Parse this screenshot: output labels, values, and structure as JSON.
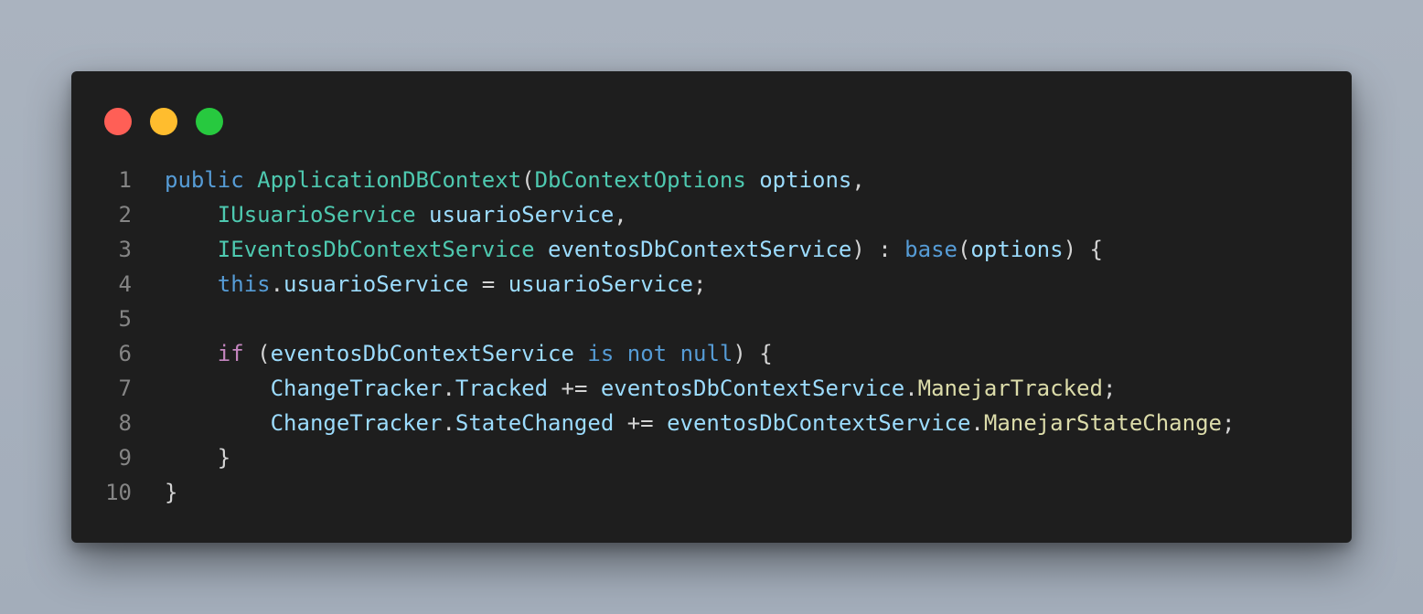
{
  "window": {
    "traffic_lights": [
      {
        "name": "close",
        "color": "#ff5f56"
      },
      {
        "name": "minimize",
        "color": "#ffbd2e"
      },
      {
        "name": "maximize",
        "color": "#27c93f"
      }
    ]
  },
  "theme": {
    "background": "#1e1e1e",
    "keyword": "#569cd6",
    "control": "#c586c0",
    "type": "#4ec9b0",
    "variable": "#9cdcfe",
    "function": "#dcdcaa",
    "punctuation": "#d4d4d4",
    "line_number": "#858585"
  },
  "code": {
    "lines": [
      {
        "n": "1",
        "tokens": [
          {
            "t": "kw",
            "v": "public"
          },
          {
            "t": "pun",
            "v": " "
          },
          {
            "t": "typ",
            "v": "ApplicationDBContext"
          },
          {
            "t": "pun",
            "v": "("
          },
          {
            "t": "typ",
            "v": "DbContextOptions"
          },
          {
            "t": "pun",
            "v": " "
          },
          {
            "t": "var",
            "v": "options"
          },
          {
            "t": "pun",
            "v": ","
          }
        ]
      },
      {
        "n": "2",
        "tokens": [
          {
            "t": "pun",
            "v": "    "
          },
          {
            "t": "typ",
            "v": "IUsuarioService"
          },
          {
            "t": "pun",
            "v": " "
          },
          {
            "t": "var",
            "v": "usuarioService"
          },
          {
            "t": "pun",
            "v": ","
          }
        ]
      },
      {
        "n": "3",
        "tokens": [
          {
            "t": "pun",
            "v": "    "
          },
          {
            "t": "typ",
            "v": "IEventosDbContextService"
          },
          {
            "t": "pun",
            "v": " "
          },
          {
            "t": "var",
            "v": "eventosDbContextService"
          },
          {
            "t": "pun",
            "v": ") : "
          },
          {
            "t": "kw",
            "v": "base"
          },
          {
            "t": "pun",
            "v": "("
          },
          {
            "t": "var",
            "v": "options"
          },
          {
            "t": "pun",
            "v": ") {"
          }
        ]
      },
      {
        "n": "4",
        "tokens": [
          {
            "t": "pun",
            "v": "    "
          },
          {
            "t": "kw",
            "v": "this"
          },
          {
            "t": "pun",
            "v": "."
          },
          {
            "t": "var",
            "v": "usuarioService"
          },
          {
            "t": "pun",
            "v": " = "
          },
          {
            "t": "var",
            "v": "usuarioService"
          },
          {
            "t": "pun",
            "v": ";"
          }
        ]
      },
      {
        "n": "5",
        "tokens": []
      },
      {
        "n": "6",
        "tokens": [
          {
            "t": "pun",
            "v": "    "
          },
          {
            "t": "ctl",
            "v": "if"
          },
          {
            "t": "pun",
            "v": " ("
          },
          {
            "t": "var",
            "v": "eventosDbContextService"
          },
          {
            "t": "pun",
            "v": " "
          },
          {
            "t": "kw",
            "v": "is"
          },
          {
            "t": "pun",
            "v": " "
          },
          {
            "t": "kw",
            "v": "not"
          },
          {
            "t": "pun",
            "v": " "
          },
          {
            "t": "kw",
            "v": "null"
          },
          {
            "t": "pun",
            "v": ") {"
          }
        ]
      },
      {
        "n": "7",
        "tokens": [
          {
            "t": "pun",
            "v": "        "
          },
          {
            "t": "var",
            "v": "ChangeTracker"
          },
          {
            "t": "pun",
            "v": "."
          },
          {
            "t": "var",
            "v": "Tracked"
          },
          {
            "t": "pun",
            "v": " += "
          },
          {
            "t": "var",
            "v": "eventosDbContextService"
          },
          {
            "t": "pun",
            "v": "."
          },
          {
            "t": "fn",
            "v": "ManejarTracked"
          },
          {
            "t": "pun",
            "v": ";"
          }
        ]
      },
      {
        "n": "8",
        "tokens": [
          {
            "t": "pun",
            "v": "        "
          },
          {
            "t": "var",
            "v": "ChangeTracker"
          },
          {
            "t": "pun",
            "v": "."
          },
          {
            "t": "var",
            "v": "StateChanged"
          },
          {
            "t": "pun",
            "v": " += "
          },
          {
            "t": "var",
            "v": "eventosDbContextService"
          },
          {
            "t": "pun",
            "v": "."
          },
          {
            "t": "fn",
            "v": "ManejarStateChange"
          },
          {
            "t": "pun",
            "v": ";"
          }
        ]
      },
      {
        "n": "9",
        "tokens": [
          {
            "t": "pun",
            "v": "    }"
          }
        ]
      },
      {
        "n": "10",
        "tokens": [
          {
            "t": "pun",
            "v": "}"
          }
        ]
      }
    ]
  }
}
